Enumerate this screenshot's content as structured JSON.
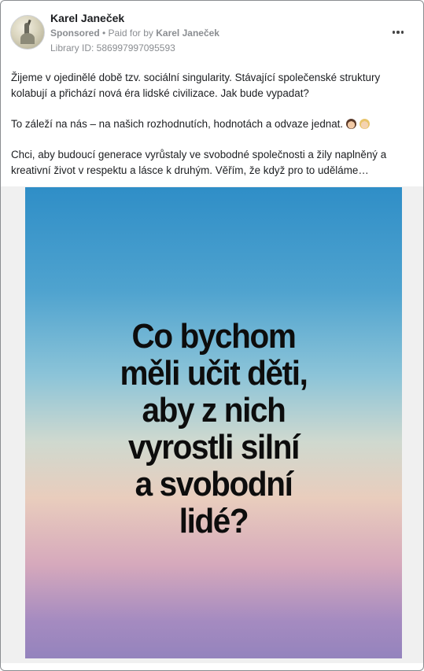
{
  "post": {
    "author": "Karel Janeček",
    "sponsored": "Sponsored",
    "paid_for_prefix": " • Paid for by ",
    "paid_for_name": "Karel Janeček",
    "library_id": "Library ID: 586997997095593",
    "paragraphs": [
      "Žijeme v ojedinělé době tzv. sociální singularity. Stávající společenské struktury kolabují a přichází nová éra lidské civilizace. Jak bude vypadat?",
      "To záleží na nás – na našich rozhodnutích, hodnotách a odvaze jednat.",
      "Chci, aby budoucí generace vyrůstaly ve svobodné společnosti a žily naplněný a kreativní život v respektu a lásce k druhým. Věřím, že když pro to uděláme…"
    ],
    "emojis": [
      "girl-emoji",
      "boy-emoji"
    ]
  },
  "media": {
    "poster_lines": [
      "Co bychom",
      "měli učit děti,",
      "aby z nich",
      "vyrostli silní",
      "a svobodní",
      "lidé?"
    ]
  },
  "icons": {
    "more": "more-options-icon",
    "avatar": "profile-avatar"
  }
}
